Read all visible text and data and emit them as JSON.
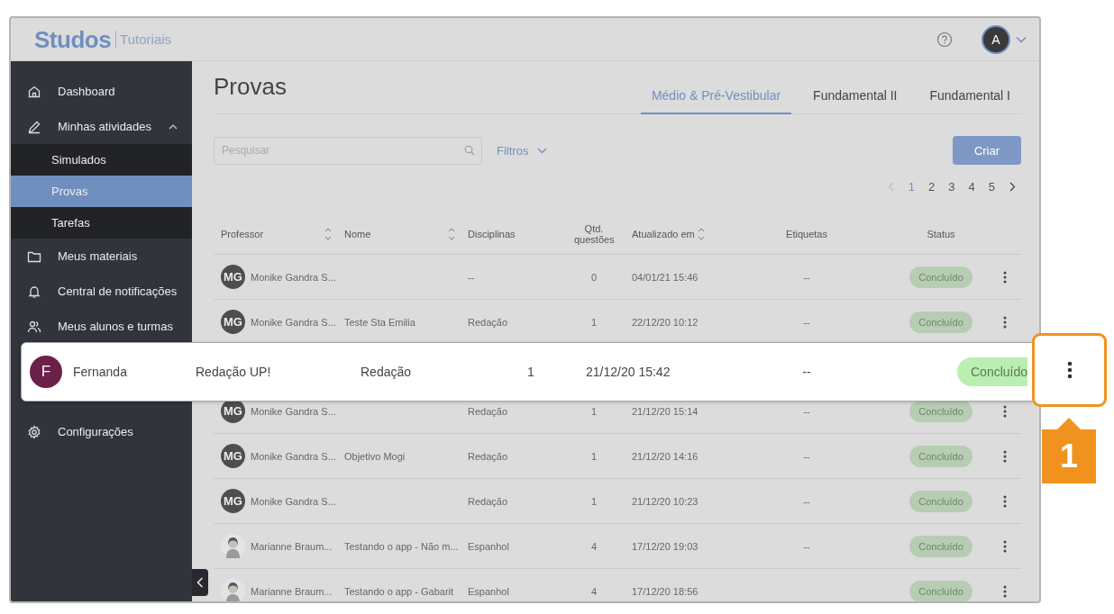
{
  "header": {
    "logo": "Studos",
    "product": "Tutoriais",
    "user_initial": "A"
  },
  "sidebar": {
    "items": [
      {
        "label": "Dashboard"
      },
      {
        "label": "Minhas atividades",
        "expanded": true,
        "children": [
          {
            "label": "Simulados",
            "selected": false
          },
          {
            "label": "Provas",
            "selected": true
          },
          {
            "label": "Tarefas",
            "selected": false
          }
        ]
      },
      {
        "label": "Meus materiais"
      },
      {
        "label": "Central de notificações"
      },
      {
        "label": "Meus alunos e turmas"
      }
    ],
    "bottom_items": [
      {
        "label": "Configurações"
      }
    ]
  },
  "page": {
    "title": "Provas",
    "tabs": [
      {
        "label": "Médio & Pré-Vestibular",
        "selected": true
      },
      {
        "label": "Fundamental II",
        "selected": false
      },
      {
        "label": "Fundamental I",
        "selected": false
      }
    ],
    "search": {
      "placeholder": "Pesquisar"
    },
    "filter": "Filtros",
    "create_button": "Criar",
    "pagination": [
      {
        "label": "1",
        "selected": true
      },
      {
        "label": "2",
        "selected": false
      },
      {
        "label": "3",
        "selected": false
      },
      {
        "label": "4",
        "selected": false
      },
      {
        "label": "5",
        "selected": false
      }
    ]
  },
  "table": {
    "columns": [
      {
        "label": "Professor",
        "sortable": true
      },
      {
        "label": "Nome",
        "sortable": true
      },
      {
        "label": "Disciplinas",
        "sortable": false
      },
      {
        "label": "Qtd. questões",
        "sortable": false
      },
      {
        "label": "Atualizado em",
        "sortable": true
      },
      {
        "label": "Etiquetas",
        "sortable": false
      },
      {
        "label": "Status",
        "sortable": false
      }
    ],
    "rows": [
      {
        "kind": "row",
        "initials": "MG",
        "professor": "Monike Gandra S...",
        "disciplinas": "--",
        "qtd": "0",
        "atualizado": "04/01/21 15:46",
        "etiquetas": "--",
        "status": "Concluído"
      },
      {
        "kind": "row",
        "initials": "MG",
        "professor": "Monike Gandra S...",
        "nome": "Teste Sta Emilia",
        "disciplinas": "Redação",
        "qtd": "1",
        "atualizado": "22/12/20 10:12",
        "etiquetas": "--",
        "status": "Concluído"
      },
      {
        "kind": "highlighted"
      },
      {
        "kind": "row",
        "initials": "MG",
        "professor": "Monike Gandra S...",
        "disciplinas": "Redação",
        "qtd": "1",
        "atualizado": "21/12/20 15:14",
        "etiquetas": "--",
        "status": "Concluído"
      },
      {
        "kind": "row",
        "initials": "MG",
        "professor": "Monike Gandra S...",
        "nome": "Objetivo Mogi",
        "disciplinas": "Redação",
        "qtd": "1",
        "atualizado": "21/12/20 14:16",
        "etiquetas": "--",
        "status": "Concluído"
      },
      {
        "kind": "row",
        "initials": "MG",
        "professor": "Monike Gandra S...",
        "disciplinas": "Redação",
        "qtd": "1",
        "atualizado": "21/12/20 10:23",
        "etiquetas": "--",
        "status": "Concluído"
      },
      {
        "kind": "row",
        "professor": "Marianne Braum...",
        "nome": "Testando o app - Não m...",
        "disciplinas": "Espanhol",
        "qtd": "4",
        "atualizado": "17/12/20 19:03",
        "etiquetas": "--",
        "status": "Concluído"
      },
      {
        "kind": "row",
        "professor": "Marianne Braum...",
        "nome": "Testando o app - Gabarit",
        "disciplinas": "Espanhol",
        "qtd": "4",
        "atualizado": "17/12/20 18:56",
        "status": "Concluído"
      }
    ]
  },
  "callout": {
    "initial": "F",
    "professor": "Fernanda",
    "nome": "Redação UP!",
    "disciplinas": "Redação",
    "qtd": "1",
    "atualizado": "21/12/20 15:42",
    "etiquetas": "--",
    "status": "Concluído",
    "step": "1"
  }
}
